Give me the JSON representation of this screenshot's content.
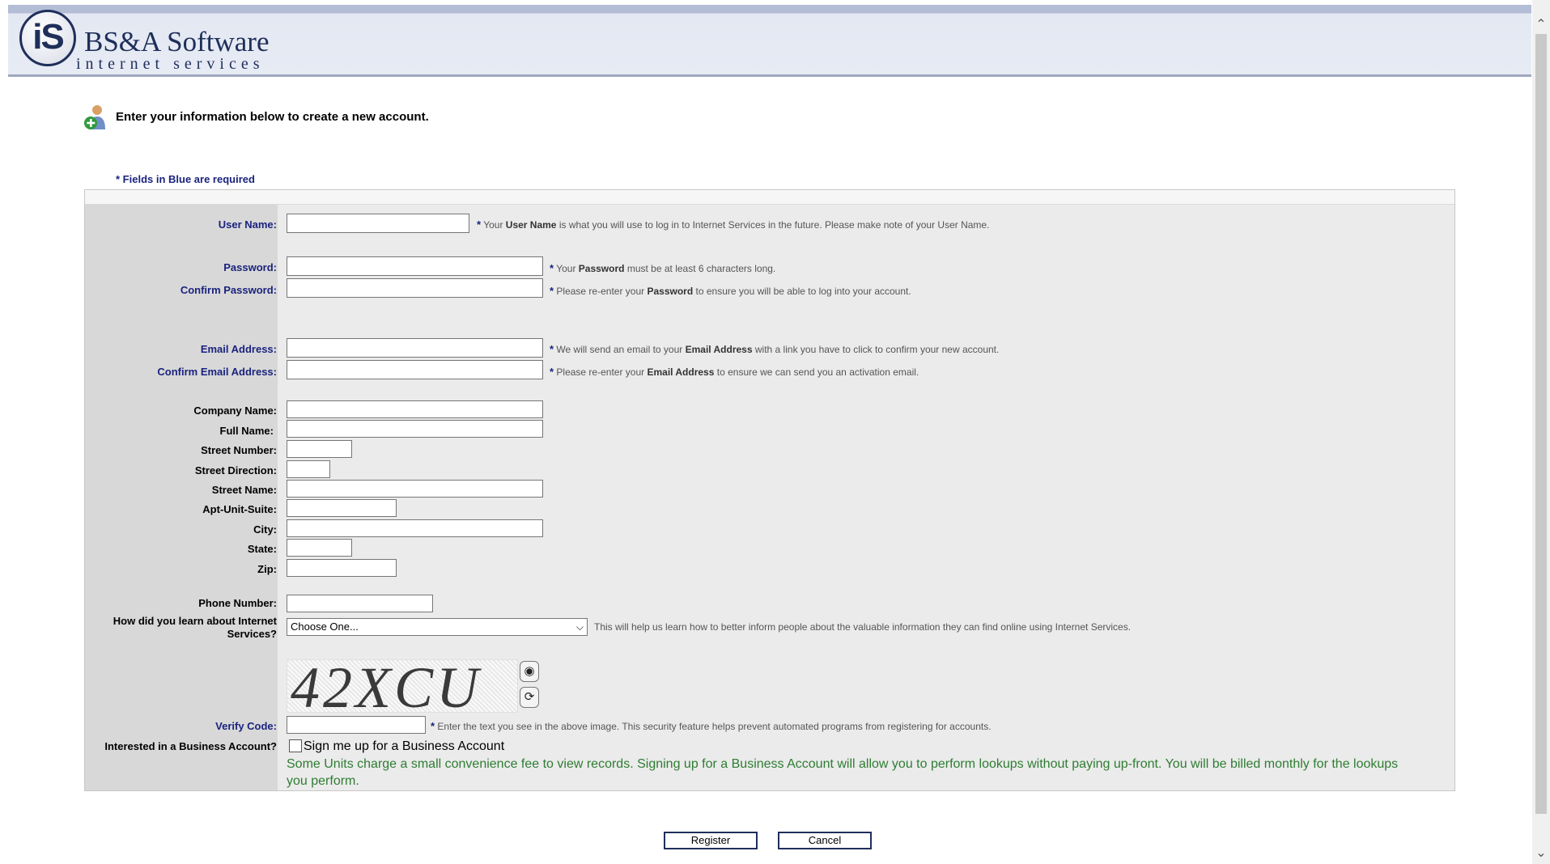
{
  "header": {
    "logo_mark": "iS",
    "brand": "BS&A Software",
    "brand_sub": "internet services"
  },
  "intro": {
    "text": "Enter your information below to create a new account.",
    "required_note": "* Fields in Blue are required"
  },
  "form": {
    "username": {
      "label": "User Name:"
    },
    "password": {
      "label": "Password:"
    },
    "confirm_password": {
      "label": "Confirm Password:"
    },
    "email": {
      "label": "Email Address:"
    },
    "confirm_email": {
      "label": "Confirm Email Address:"
    },
    "company_name": {
      "label": "Company Name:"
    },
    "full_name": {
      "label": "Full Name:"
    },
    "street_number": {
      "label": "Street Number:"
    },
    "street_direction": {
      "label": "Street Direction:"
    },
    "street_name": {
      "label": "Street Name:"
    },
    "apt_unit_suite": {
      "label": "Apt-Unit-Suite:"
    },
    "city": {
      "label": "City:"
    },
    "state": {
      "label": "State:"
    },
    "zip": {
      "label": "Zip:"
    },
    "phone": {
      "label": "Phone Number:"
    },
    "learn": {
      "label_line1": "How did you learn about Internet",
      "label_line2": "Services?",
      "selected": "Choose One...",
      "hint": "This will help us learn how to better inform people about the valuable information they can find online using Internet Services."
    },
    "captcha": {
      "text": "42XCU"
    },
    "verify": {
      "label": "Verify Code:",
      "hint": "Enter the text you see in the above image. This security feature helps prevent automated programs from registering for accounts."
    },
    "business": {
      "label": "Interested in a Business Account?",
      "checkbox_label": "Sign me up for a Business Account",
      "checked": false,
      "note": "Some Units charge a small convenience fee to view records. Signing up for a Business Account will allow you to perform lookups without paying up-front. You will be billed monthly for the lookups you perform."
    }
  },
  "hints": {
    "username": {
      "pre": "Your",
      "bold": "User Name",
      "post": "is what you will use to log in to Internet Services in the future. Please make note of your User Name."
    },
    "password": {
      "pre": "Your",
      "bold": "Password",
      "post": "must be at least 6 characters long."
    },
    "confirm_password": {
      "pre": "Please re-enter your",
      "bold": "Password",
      "post": "to ensure you will be able to log into your account."
    },
    "email": {
      "pre": "We will send an email to your",
      "bold": "Email Address",
      "post": "with a link you have to click to confirm your new account."
    },
    "confirm_email": {
      "pre": "Please re-enter your",
      "bold": "Email Address",
      "post": "to ensure we can send you an activation email."
    }
  },
  "buttons": {
    "register": "Register",
    "cancel": "Cancel"
  },
  "icons": {
    "add_user": "add-user-icon",
    "audio": "speaker-icon",
    "refresh": "refresh-icon"
  },
  "colors": {
    "required_blue": "#1a237e",
    "business_note_green": "#2e7d32",
    "header_navy": "#1f2f5a"
  }
}
